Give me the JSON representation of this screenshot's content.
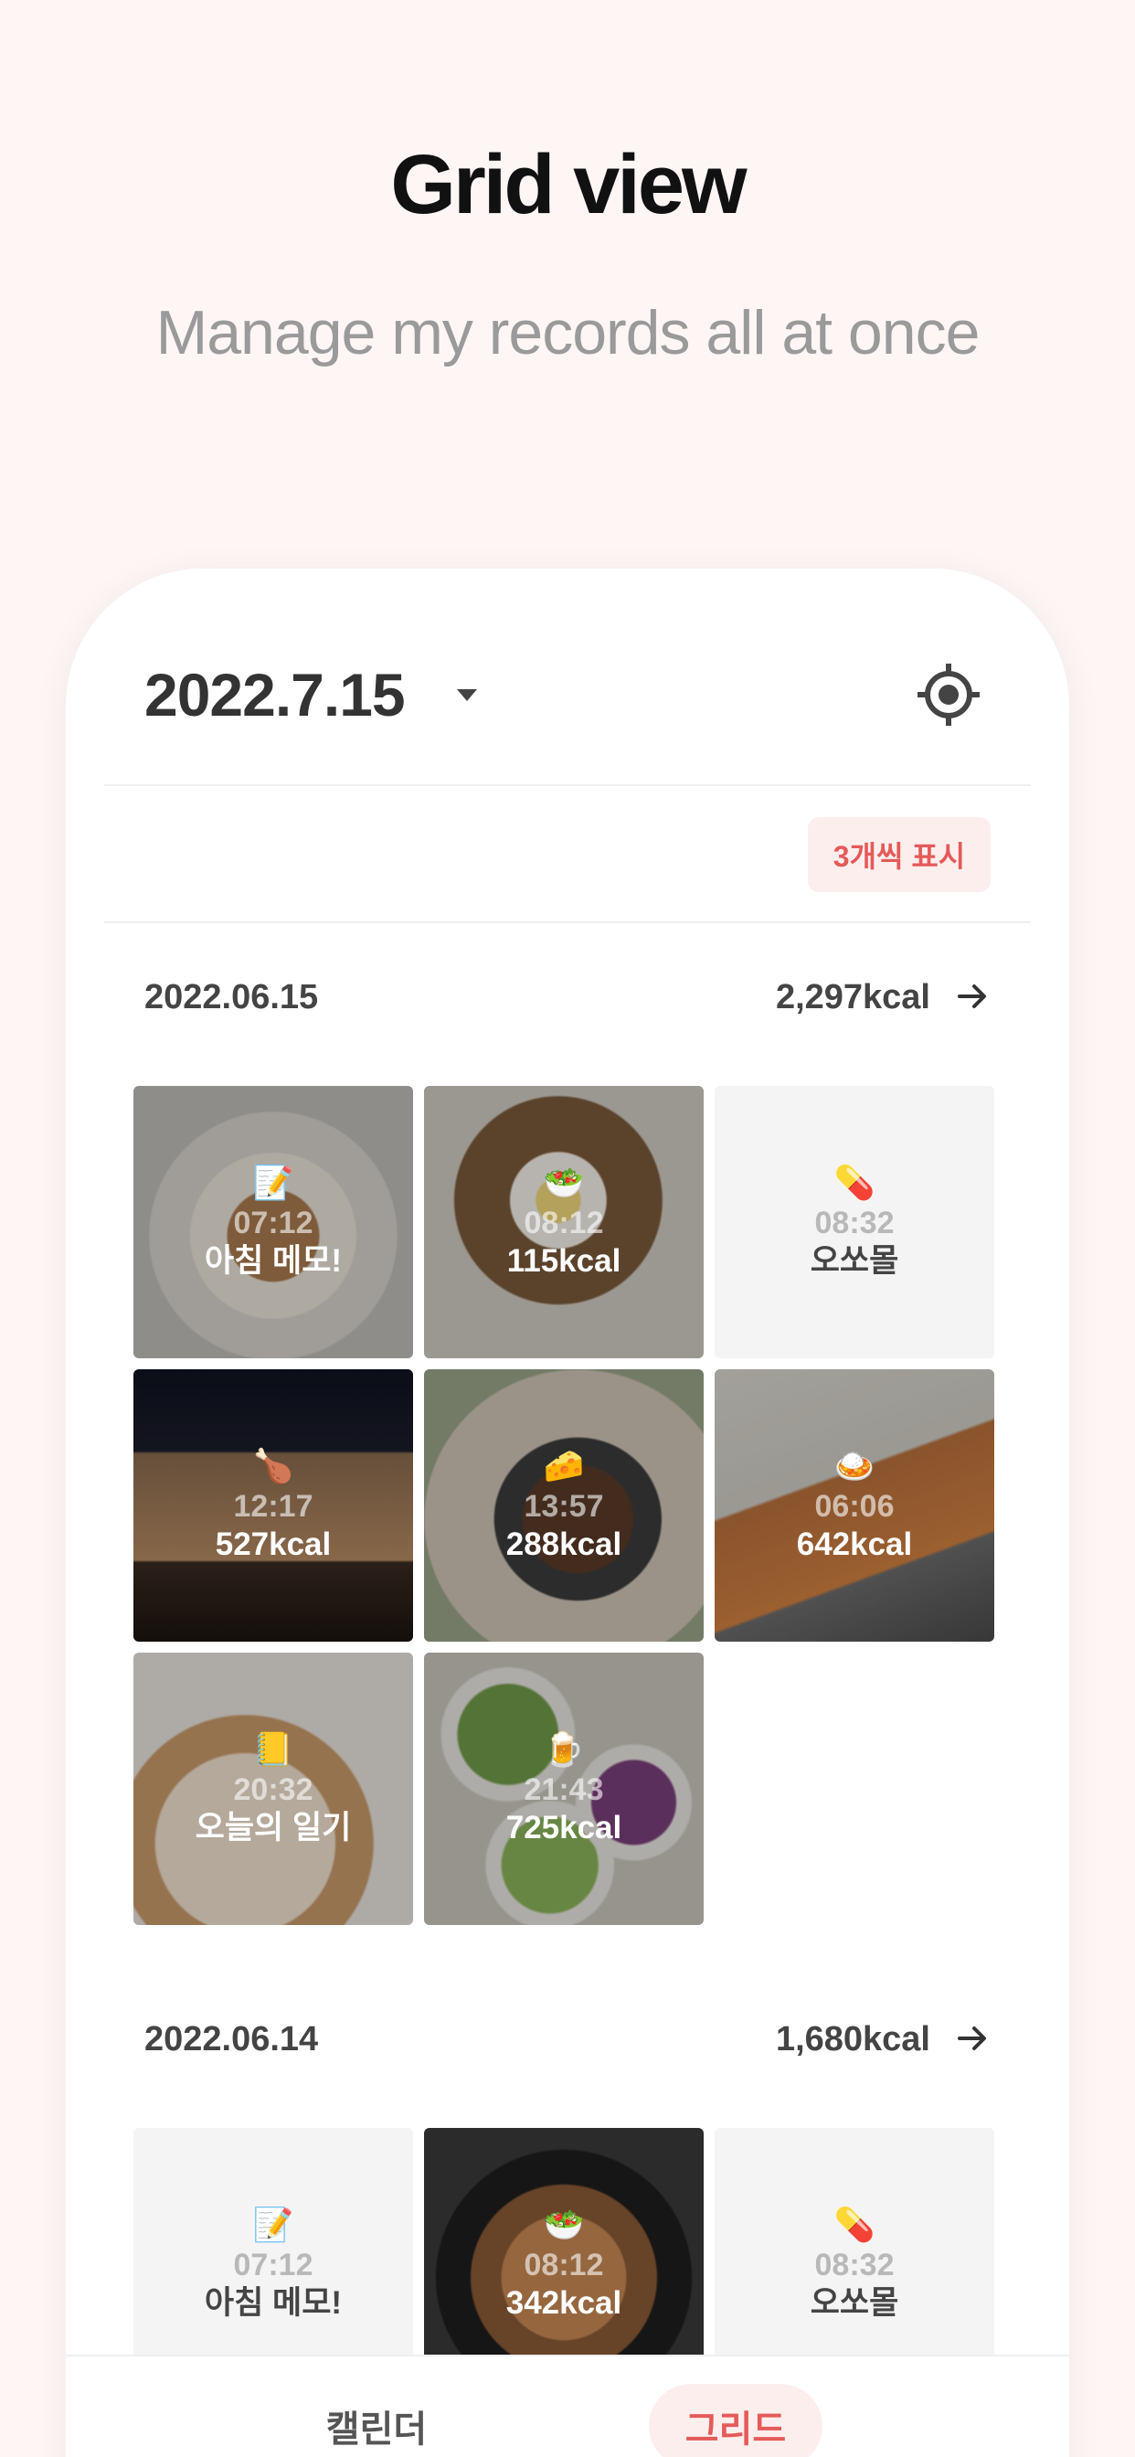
{
  "hero": {
    "title": "Grid view",
    "subtitle": "Manage my records all at once"
  },
  "header": {
    "date": "2022.7.15",
    "locate_icon": "target-icon"
  },
  "toolbar": {
    "count_button_label": "3개씩 표시"
  },
  "colors": {
    "accent": "#e55a5a",
    "accent_bg": "#fdeeee",
    "page_bg": "#fdf6f5"
  },
  "days": [
    {
      "date": "2022.06.15",
      "kcal": "2,297kcal",
      "tiles": [
        {
          "emoji": "📝",
          "time": "07:12",
          "label": "아침 메모!",
          "kind": "photo-plate"
        },
        {
          "emoji": "🥗",
          "time": "08:12",
          "label": "115kcal",
          "kind": "photo-toast"
        },
        {
          "emoji": "💊",
          "time": "08:32",
          "label": "오쏘몰",
          "kind": "plain"
        },
        {
          "emoji": "🍗",
          "time": "12:17",
          "label": "527kcal",
          "kind": "photo-pancake"
        },
        {
          "emoji": "🧀",
          "time": "13:57",
          "label": "288kcal",
          "kind": "photo-meatball"
        },
        {
          "emoji": "🍛",
          "time": "06:06",
          "label": "642kcal",
          "kind": "photo-drink"
        },
        {
          "emoji": "📒",
          "time": "20:32",
          "label": "오늘의 일기",
          "kind": "photo-pizza"
        },
        {
          "emoji": "🍺",
          "time": "21:43",
          "label": "725kcal",
          "kind": "photo-salad"
        }
      ]
    },
    {
      "date": "2022.06.14",
      "kcal": "1,680kcal",
      "tiles": [
        {
          "emoji": "📝",
          "time": "07:12",
          "label": "아침 메모!",
          "kind": "plain"
        },
        {
          "emoji": "🥗",
          "time": "08:12",
          "label": "342kcal",
          "kind": "photo-pasta"
        },
        {
          "emoji": "💊",
          "time": "08:32",
          "label": "오쏘몰",
          "kind": "plain"
        }
      ]
    }
  ],
  "tabs": {
    "calendar": "캘린더",
    "grid": "그리드"
  }
}
